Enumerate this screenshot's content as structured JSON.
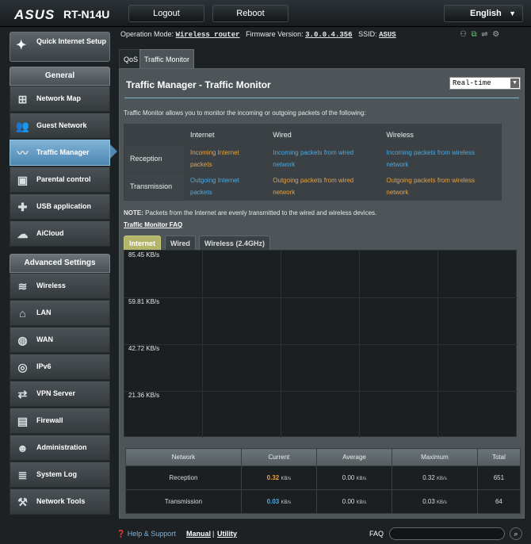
{
  "header": {
    "brand": "ASUS",
    "model": "RT-N14U",
    "logout": "Logout",
    "reboot": "Reboot",
    "language": "English"
  },
  "status": {
    "op_mode_label": "Operation Mode:",
    "op_mode": "Wireless router",
    "fw_label": "Firmware Version:",
    "fw": "3.0.0.4.356",
    "ssid_label": "SSID:",
    "ssid": "ASUS"
  },
  "sidebar": {
    "qis": "Quick Internet Setup",
    "general": "General",
    "items": [
      "Network Map",
      "Guest Network",
      "Traffic Manager",
      "Parental control",
      "USB application",
      "AiCloud"
    ],
    "advanced": "Advanced Settings",
    "adv_items": [
      "Wireless",
      "LAN",
      "WAN",
      "IPv6",
      "VPN Server",
      "Firewall",
      "Administration",
      "System Log",
      "Network Tools"
    ]
  },
  "tabs": {
    "qos": "QoS",
    "tm": "Traffic Monitor"
  },
  "page": {
    "title": "Traffic Manager - Traffic Monitor",
    "mode": "Real-time",
    "desc": "Traffic Monitor allows you to monitor the incoming or outgoing packets of the following:",
    "cols": [
      "Internet",
      "Wired",
      "Wireless"
    ],
    "reception": "Reception",
    "transmission": "Transmission",
    "rx": [
      "Incoming Internet packets",
      "Incoming packets from wired network",
      "Incoming packets from wireless network"
    ],
    "tx": [
      "Outgoing Internet packets",
      "Outgoing packets from wired network",
      "Outgoing packets from wireless network"
    ],
    "note_b": "NOTE:",
    "note": " Packets from the Internet are evenly transmitted to the wired and wireless devices.",
    "faq": "Traffic Monitor FAQ",
    "gtabs": [
      "Internet",
      "Wired",
      "Wireless (2.4GHz)"
    ],
    "ylabels": [
      "85.45 KB/s",
      "59.81 KB/s",
      "42.72 KB/s",
      "21.36 KB/s"
    ]
  },
  "stats": {
    "headers": [
      "Network",
      "Current",
      "Average",
      "Maximum",
      "Total"
    ],
    "unit": "KB/s",
    "rows": [
      {
        "name": "Reception",
        "current": "0.32",
        "average": "0.00",
        "maximum": "0.32",
        "total": "651"
      },
      {
        "name": "Transmission",
        "current": "0.03",
        "average": "0.00",
        "maximum": "0.03",
        "total": "64"
      }
    ]
  },
  "footer": {
    "help": "Help & Support",
    "manual": "Manual",
    "sep": "|",
    "utility": "Utility",
    "faq": "FAQ"
  },
  "colors": {
    "accent": "#4e87b3",
    "orange": "#e3a24a",
    "blue": "#4ea9e0"
  }
}
